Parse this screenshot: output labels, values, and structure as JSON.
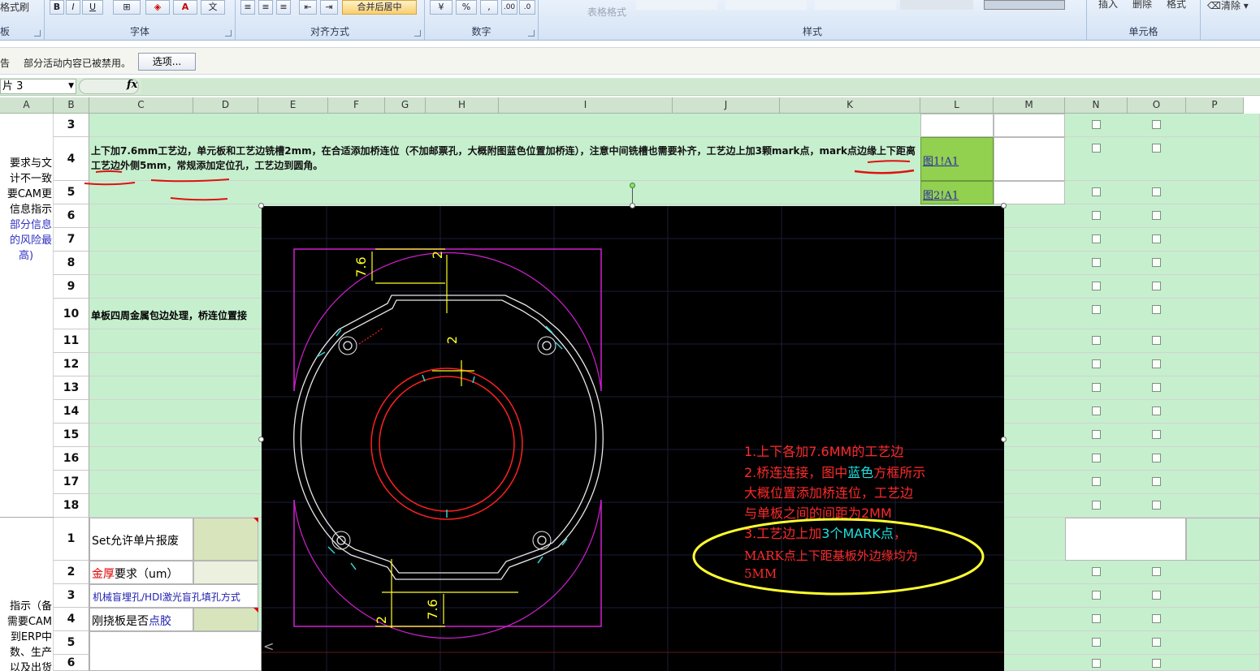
{
  "ribbon": {
    "format_painter": "格式刷",
    "clipboard_label": "板",
    "font_label": "字体",
    "align_label": "对齐方式",
    "number_label": "数字",
    "styles_label": "样式",
    "cells_label": "单元格",
    "merge_center": "合并后居中",
    "percent": "%",
    "comma": ",",
    "table_format": "表格格式",
    "insert": "插入",
    "delete": "删除",
    "format": "格式",
    "clear": "清除"
  },
  "message_bar": {
    "title": "警告",
    "text": "部分活动内容已被禁用。",
    "options_button": "选项..."
  },
  "formula_bar": {
    "name_box": "片 3",
    "fx": "fx"
  },
  "columns": [
    "A",
    "B",
    "C",
    "D",
    "E",
    "F",
    "G",
    "H",
    "I",
    "J",
    "K",
    "L",
    "M",
    "N",
    "O",
    "P"
  ],
  "rows": [
    "3",
    "4",
    "5",
    "6",
    "7",
    "8",
    "9",
    "10",
    "11",
    "12",
    "13",
    "14",
    "15",
    "16",
    "17",
    "18",
    "1",
    "2",
    "3",
    "4",
    "5",
    "6"
  ],
  "cells": {
    "row4_text": "上下加7.6mm工艺边，单元板和工艺边铣槽2mm，在合适添加桥连位（不加邮票孔，大概附图蓝色位置加桥连），注意中间铣槽也需要补齐，工艺边上加3颗mark点，mark点边缘上下距离工艺边外侧5mm，常规添加定位孔，工艺边到圆角。",
    "row10_text": "单板四周金属包边处理，桥连位置接",
    "link1": "图1!A1",
    "link2": "图2!A1",
    "colA_top": [
      "要求与文",
      "计不一致",
      "要CAM更",
      "信息指示"
    ],
    "colA_top_blue": [
      "部分信息",
      "的风险最",
      "高)"
    ],
    "colA_bottom": [
      "指示（备",
      "需要CAM",
      "到ERP中",
      "数、生产",
      "以及出货"
    ],
    "set_label": "Set允许单片报废",
    "gold_thick_red": "金厚",
    "gold_thick_rest": "要求（um）",
    "blind_hole": "机械盲埋孔/HDI激光盲孔填孔方式",
    "rigid_flex_a": "刚挠板是否",
    "rigid_flex_b": "点胶"
  },
  "drawing": {
    "dim_top_margin": "7.6",
    "dim_top_slot": "2",
    "dim_inner_slot": "2",
    "dim_bottom_slot": "2",
    "dim_bottom_margin": "7.6",
    "note1": "1.上下各加7.6MM的工艺边",
    "note2_a": "2.桥连连接，图中",
    "note2_b": "蓝色",
    "note2_c": "方框所示",
    "note3": "大概位置添加桥连位，工艺边",
    "note4": "与单板之间的间距为2MM",
    "note5_a": "3.工艺边上加",
    "note5_b": "3个MARK点",
    "note5_c": "，",
    "note6": "MARK点上下距基板外边缘均为",
    "note7": "5MM",
    "colors": {
      "outline": "#ffffff",
      "frame": "#d020d0",
      "circle": "#ff2020",
      "dim": "#ffff20",
      "bridge": "#30d0d0",
      "note": "#ff2a2a",
      "note_cyan": "#20e0e0",
      "ellipse": "#ffff30"
    }
  }
}
